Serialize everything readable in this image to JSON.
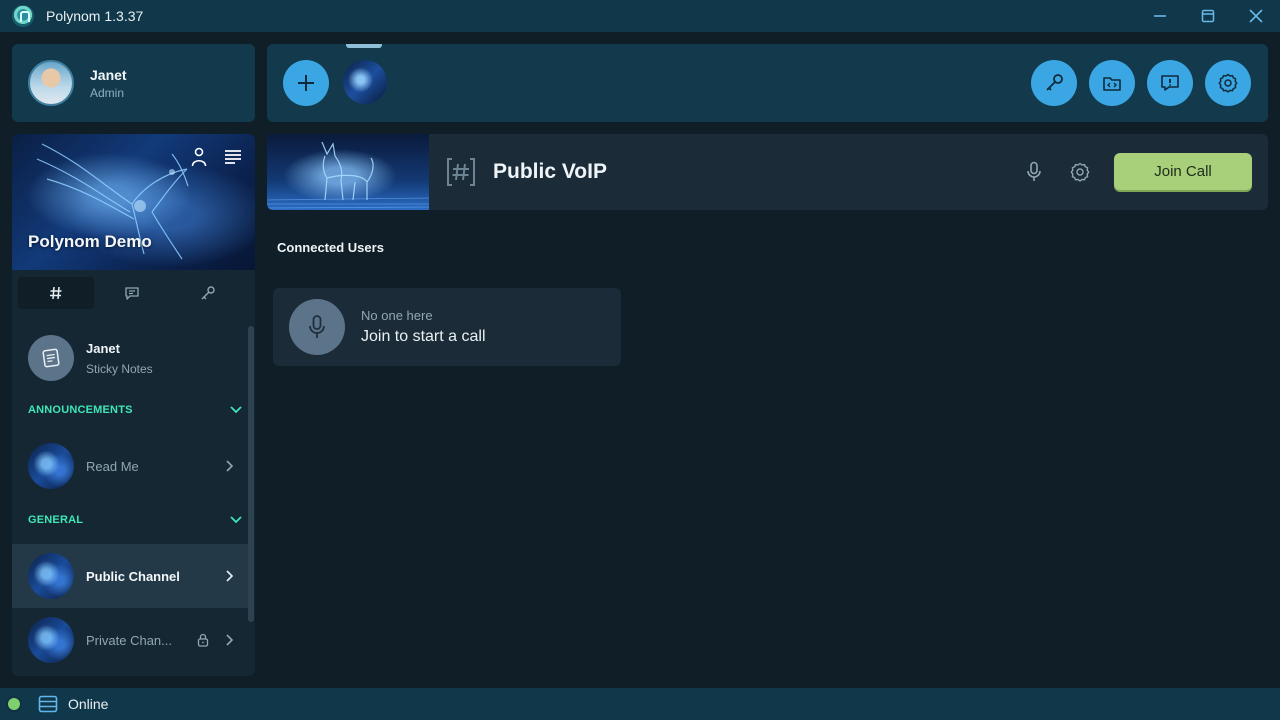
{
  "window": {
    "title": "Polynom 1.3.37",
    "controls": [
      "minimize-icon",
      "maximize-icon",
      "close-icon"
    ]
  },
  "user": {
    "name": "Janet",
    "role": "Admin"
  },
  "server": {
    "name": "Polynom Demo"
  },
  "sidebar_tabs": [
    {
      "icon": "hash-icon",
      "active": true
    },
    {
      "icon": "message-icon",
      "active": false
    },
    {
      "icon": "key-icon",
      "active": false
    }
  ],
  "sticky_note": {
    "title": "Janet",
    "subtitle": "Sticky Notes"
  },
  "categories": [
    {
      "label": "ANNOUNCEMENTS",
      "channels": [
        {
          "label": "Read Me",
          "locked": false,
          "active": false
        }
      ]
    },
    {
      "label": "GENERAL",
      "channels": [
        {
          "label": "Public Channel",
          "locked": false,
          "active": true
        },
        {
          "label": "Private Chan...",
          "locked": true,
          "active": false
        }
      ]
    }
  ],
  "toolbar": {
    "right_buttons": [
      "key-icon",
      "folder-code-icon",
      "feedback-icon",
      "settings-icon"
    ]
  },
  "channel": {
    "title": "Public VoIP",
    "join_label": "Join Call"
  },
  "connected": {
    "heading": "Connected Users",
    "empty_top": "No one here",
    "empty_bottom": "Join to start a call"
  },
  "status": {
    "text": "Online"
  },
  "colors": {
    "accent_blue": "#3aa6e3",
    "category_green": "#3ee6b8",
    "join_button": "#a8cf79",
    "online": "#7fcf6e"
  }
}
